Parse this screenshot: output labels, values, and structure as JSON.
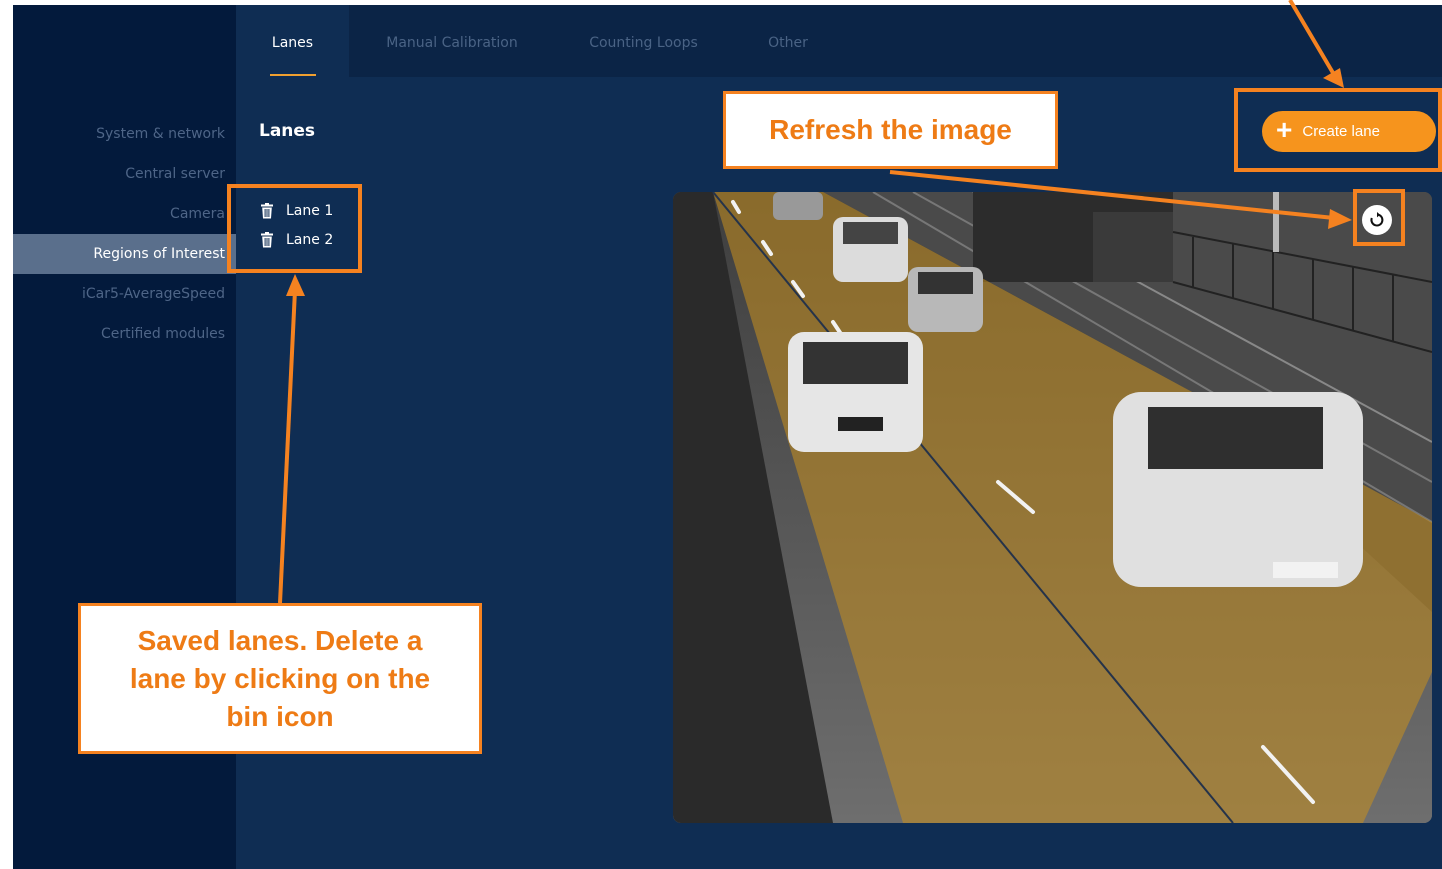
{
  "sidebar": {
    "items": [
      {
        "label": "System & network",
        "active": false
      },
      {
        "label": "Central server",
        "active": false
      },
      {
        "label": "Camera",
        "active": false
      },
      {
        "label": "Regions of Interest",
        "active": true
      },
      {
        "label": "iCar5-AverageSpeed",
        "active": false
      },
      {
        "label": "Certified modules",
        "active": false
      }
    ]
  },
  "tabs": [
    {
      "label": "Lanes",
      "active": true
    },
    {
      "label": "Manual Calibration",
      "active": false
    },
    {
      "label": "Counting Loops",
      "active": false
    },
    {
      "label": "Other",
      "active": false
    }
  ],
  "panel": {
    "title": "Lanes",
    "lanes": [
      {
        "label": "Lane 1",
        "icon": "bin-icon"
      },
      {
        "label": "Lane 2",
        "icon": "bin-icon"
      }
    ]
  },
  "toolbar": {
    "create_label": "Create lane",
    "create_icon": "plus-icon",
    "refresh_icon": "refresh-icon"
  },
  "annotations": {
    "refresh": "Refresh the image",
    "saved_lanes": [
      "Saved lanes. Delete a",
      "lane by clicking on the",
      "bin icon"
    ]
  },
  "colors": {
    "background": "#0f2d53",
    "sidebar": "#031a3c",
    "accent": "#f6941d",
    "annotation": "#f58220",
    "lane_overlay": "#c8901e"
  }
}
